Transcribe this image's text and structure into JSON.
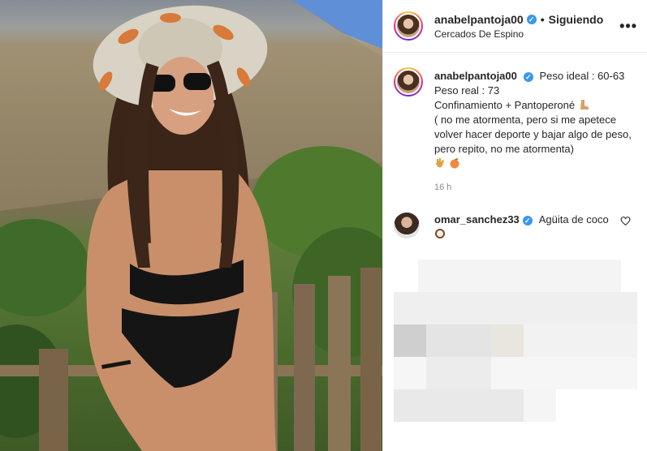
{
  "post": {
    "author": "anabelpantoja00",
    "follow_label": "Siguiendo",
    "separator": "•",
    "location": "Cercados De Espino",
    "more_label": "•••"
  },
  "caption": {
    "username": "anabelpantoja00",
    "line1": "Peso ideal : 60-63",
    "line2": "Peso real : 73",
    "line3": "Confinamiento + Pantoperoné",
    "line4": "( no me atormenta, pero si me apetece volver hacer deporte y bajar algo de peso, pero repito, no me atormenta)",
    "time": "16 h"
  },
  "comment": {
    "username": "omar_sanchez33",
    "text": "Agüita de coco"
  },
  "icons": {
    "verified": "verified-badge-icon",
    "heart": "heart-outline-icon",
    "more": "more-options-icon"
  },
  "colors": {
    "verified": "#3897f0",
    "secondary_text": "#8e8e8e",
    "border": "#efefef"
  }
}
